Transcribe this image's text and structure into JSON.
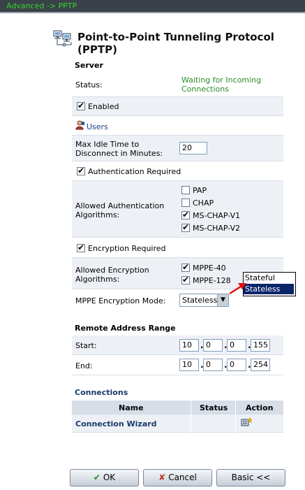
{
  "breadcrumb": "Advanced -> PPTP",
  "page": {
    "title": "Point-to-Point Tunneling Protocol (PPTP)",
    "icon": "network-computers-icon"
  },
  "server": {
    "section_title": "Server",
    "status_label": "Status:",
    "status_value_line1": "Waiting for Incoming",
    "status_value_line2": "Connections",
    "enabled_label": "Enabled",
    "enabled_checked": true,
    "users_label": "Users",
    "max_idle_label_line1": "Max Idle Time to",
    "max_idle_label_line2": "Disconnect in Minutes:",
    "max_idle_value": "20",
    "auth_required_label": "Authentication Required",
    "auth_required_checked": true,
    "allowed_auth_label_line1": "Allowed Authentication",
    "allowed_auth_label_line2": "Algorithms:",
    "auth_algorithms": [
      {
        "label": "PAP",
        "checked": false
      },
      {
        "label": "CHAP",
        "checked": false
      },
      {
        "label": "MS-CHAP-V1",
        "checked": true
      },
      {
        "label": "MS-CHAP-V2",
        "checked": true
      }
    ],
    "encryption_required_label": "Encryption Required",
    "encryption_required_checked": true,
    "allowed_enc_label_line1": "Allowed Encryption",
    "allowed_enc_label_line2": "Algorithms:",
    "enc_algorithms": [
      {
        "label": "MPPE-40",
        "checked": true
      },
      {
        "label": "MPPE-128",
        "checked": true
      }
    ],
    "mppe_mode_label": "MPPE Encryption Mode:",
    "mppe_mode_value": "Stateless",
    "mppe_mode_options": [
      "Stateful",
      "Stateless"
    ],
    "mppe_mode_highlighted": "Stateless"
  },
  "remote": {
    "section_title": "Remote Address Range",
    "start_label": "Start:",
    "start": [
      "10",
      "0",
      "0",
      "155"
    ],
    "end_label": "End:",
    "end": [
      "10",
      "0",
      "0",
      "254"
    ]
  },
  "connections": {
    "section_title": "Connections",
    "headers": [
      "Name",
      "Status",
      "Action"
    ],
    "rows": [
      {
        "name": "Connection Wizard",
        "status": "",
        "action_icon": "wizard-icon"
      }
    ]
  },
  "buttons": {
    "ok": "OK",
    "cancel": "Cancel",
    "basic": "Basic <<"
  },
  "colors": {
    "breadcrumb_bg": "#3a4148",
    "breadcrumb_text": "#35d235",
    "status_text": "#2a8a2a",
    "link": "#1a3a6a",
    "annotation_arrow": "#e01010"
  }
}
